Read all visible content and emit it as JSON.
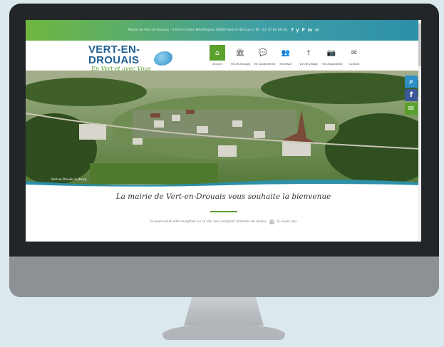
{
  "topbar": {
    "info": "Mairie de Vert-en-Drouais - 2 Rue Charles Waddington 28500 Vert-en-Drouais | Tél : 02 37 82 89 44",
    "social": [
      "f",
      "y",
      "P",
      "in",
      "✉"
    ]
  },
  "logo": {
    "brand_main": "VERT-EN-DROUAIS",
    "tagline": "En Vert et avec Vous"
  },
  "nav": [
    {
      "label": "Accueil",
      "icon": "home-icon",
      "glyph": "⌂",
      "active": true
    },
    {
      "label": "Vie Municipale",
      "icon": "building-icon",
      "glyph": "🏛",
      "active": false
    },
    {
      "label": "Vie Quotidienne",
      "icon": "speech-icon",
      "glyph": "💬",
      "active": false
    },
    {
      "label": "Jeunesse",
      "icon": "people-icon",
      "glyph": "👥",
      "active": false
    },
    {
      "label": "Vie de Village",
      "icon": "church-icon",
      "glyph": "†",
      "active": false
    },
    {
      "label": "Vie Associative",
      "icon": "camera-icon",
      "glyph": "📷",
      "active": false
    },
    {
      "label": "Contact",
      "icon": "mail-icon",
      "glyph": "✉",
      "active": false
    }
  ],
  "hero": {
    "caption": "Vert-en-Drouais le Bourg"
  },
  "side_icons": [
    {
      "name": "search-icon",
      "glyph": "⌕",
      "color": "#2d8fc4"
    },
    {
      "name": "facebook-icon",
      "glyph": "f",
      "color": "#3b5998"
    },
    {
      "name": "mail-icon",
      "glyph": "✉",
      "color": "#5aa02c"
    }
  ],
  "welcome": "La mairie de Vert-en-Drouais vous souhaite la bienvenue",
  "cookie": {
    "text": "En poursuivant votre navigation sur ce site, vous acceptez l'utilisation de cookies.",
    "ok": "OK",
    "more": "En savoir plus"
  },
  "colors": {
    "green": "#5aa02c",
    "blue": "#2d8fc4",
    "monitor": "#232629"
  }
}
